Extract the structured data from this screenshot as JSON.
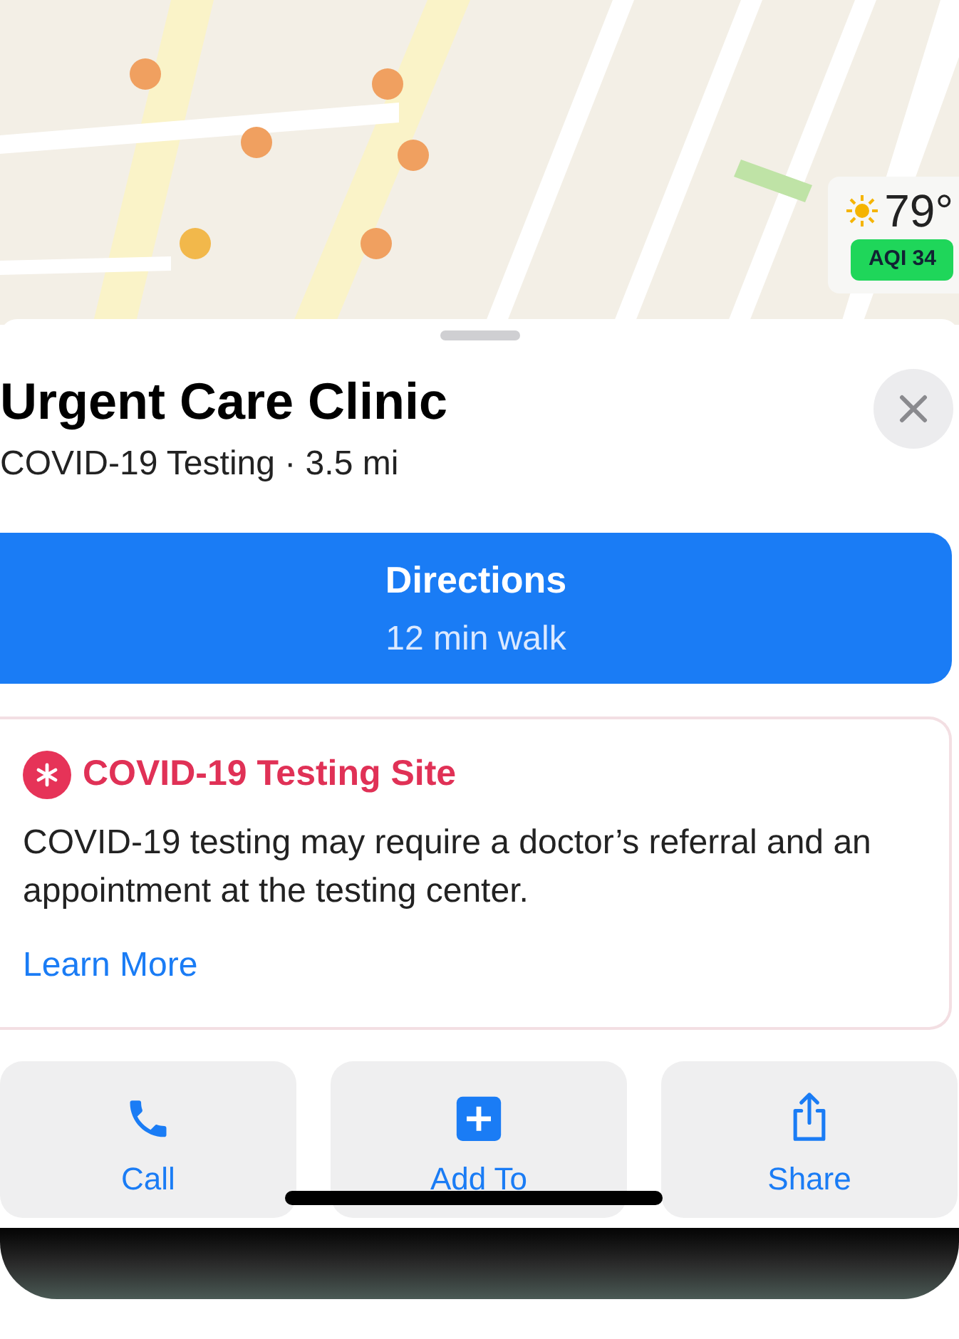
{
  "map": {
    "kind": "picture",
    "weather": {
      "temperature": "79°",
      "aqi": "AQI 34"
    }
  },
  "place": {
    "title": "Urgent Care Clinic",
    "subtitle": "COVID-19 Testing · 3.5 mi"
  },
  "directions": {
    "label": "Directions",
    "detail": "12 min walk"
  },
  "notice": {
    "title": "COVID-19 Testing Site",
    "body": "COVID-19 testing may require a doctor’s referral and an appointment at the testing center.",
    "link": "Learn More"
  },
  "actions": [
    {
      "kind": "call",
      "label": "Call"
    },
    {
      "kind": "add",
      "label": "Add To"
    },
    {
      "kind": "share",
      "label": "Share"
    }
  ]
}
